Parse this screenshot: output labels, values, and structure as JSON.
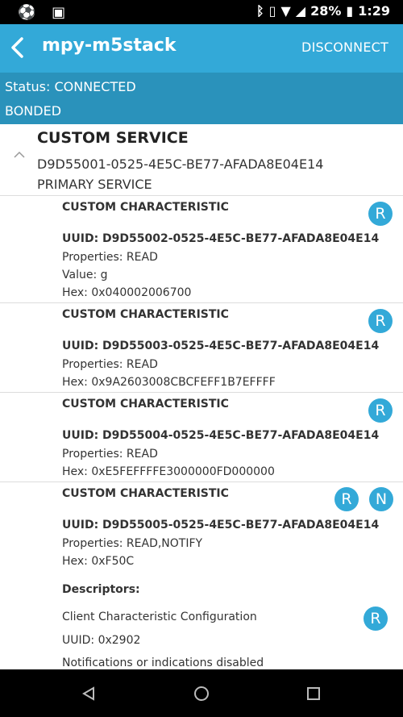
{
  "status_bar": {
    "battery": "28%",
    "time": "1:29"
  },
  "app_bar": {
    "title": "mpy-m5stack",
    "disconnect_label": "DISCONNECT"
  },
  "connection": {
    "status": "Status: CONNECTED",
    "bond": "BONDED"
  },
  "service": {
    "name": "CUSTOM SERVICE",
    "uuid": "D9D55001-0525-4E5C-BE77-AFADA8E04E14",
    "type": "PRIMARY SERVICE"
  },
  "characteristics": [
    {
      "name": "CUSTOM CHARACTERISTIC",
      "uuid": "UUID: D9D55002-0525-4E5C-BE77-AFADA8E04E14",
      "properties": "Properties: READ",
      "value": "Value: g",
      "hex": "Hex: 0x040002006700",
      "buttons": [
        "R"
      ]
    },
    {
      "name": "CUSTOM CHARACTERISTIC",
      "uuid": "UUID: D9D55003-0525-4E5C-BE77-AFADA8E04E14",
      "properties": "Properties: READ",
      "hex": "Hex: 0x9A2603008CBCFEFF1B7EFFFF",
      "buttons": [
        "R"
      ]
    },
    {
      "name": "CUSTOM CHARACTERISTIC",
      "uuid": "UUID: D9D55004-0525-4E5C-BE77-AFADA8E04E14",
      "properties": "Properties: READ",
      "hex": "Hex: 0xE5FEFFFFE3000000FD000000",
      "buttons": [
        "R"
      ]
    },
    {
      "name": "CUSTOM CHARACTERISTIC",
      "uuid": "UUID: D9D55005-0525-4E5C-BE77-AFADA8E04E14",
      "properties": "Properties: READ,NOTIFY",
      "hex": "Hex: 0xF50C",
      "buttons": [
        "R",
        "N"
      ],
      "descriptors_label": "Descriptors:",
      "descriptor": {
        "name": "Client Characteristic Configuration",
        "uuid": "UUID: 0x2902",
        "status": "Notifications or indications disabled",
        "button": "R"
      }
    }
  ],
  "colors": {
    "app_bar": "#33a9d8",
    "connection_bar": "#2a92bb",
    "button": "#33a9d8"
  }
}
